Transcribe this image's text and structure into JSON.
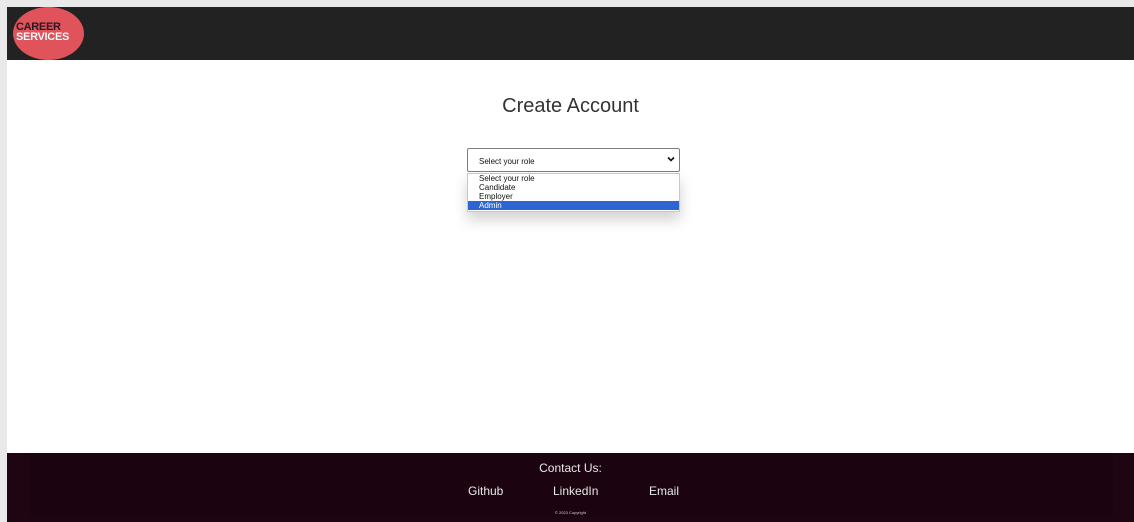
{
  "header": {
    "logo_line1": "CAREER",
    "logo_line2": "SERVICES",
    "brand_color": "#e0535a",
    "background": "#222222"
  },
  "main": {
    "title": "Create Account",
    "role_select": {
      "selected_value": "Select your role",
      "options": [
        "Select your role",
        "Candidate",
        "Employer",
        "Admin"
      ],
      "highlighted_option": "Admin",
      "highlight_color": "#2f65d2"
    }
  },
  "footer": {
    "contact_label": "Contact Us:",
    "links": [
      "Github",
      "LinkedIn",
      "Email"
    ],
    "copyright": "© 2023 Copyright",
    "background": "#1f0411"
  }
}
